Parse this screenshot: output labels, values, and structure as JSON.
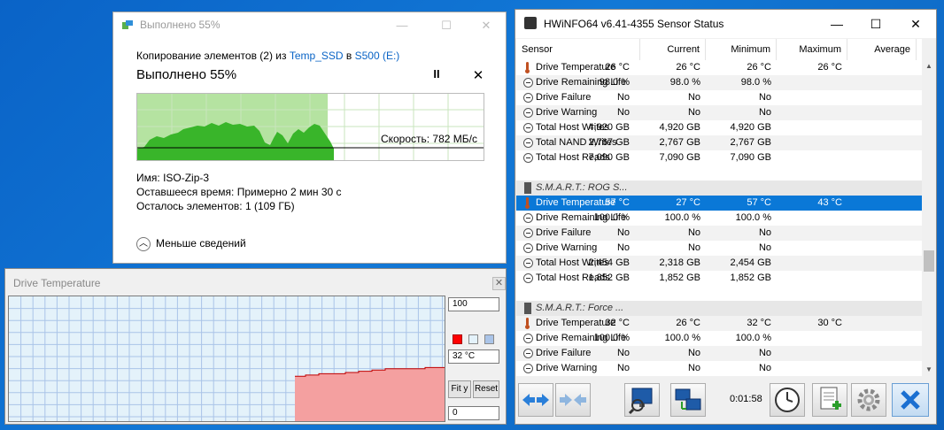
{
  "copy_dialog": {
    "title": "Выполнено 55%",
    "line_prefix": "Копирование элементов (2) из ",
    "source": "Temp_SSD",
    "line_mid": " в ",
    "destination": "S500 (E:)",
    "progress_text": "Выполнено 55%",
    "progress_value": 0.55,
    "speed_label": "Скорость: 782 МБ/с",
    "name_label": "Имя:",
    "name_value": "ISO-Zip-3",
    "time_label": "Оставшееся время:",
    "time_value": "Примерно 2 мин 30 с",
    "items_label": "Осталось элементов:",
    "items_value": "1 (109 ГБ)",
    "less_details": "Меньше сведений",
    "pause_glyph": "II",
    "close_glyph": "✕"
  },
  "drive_temp_window": {
    "title": "Drive Temperature",
    "close_glyph": "✕",
    "max_value": "100",
    "current_value": "32 °C",
    "min_value": "0",
    "fit_label": "Fit y",
    "reset_label": "Reset",
    "trace_color": "#f4a0a0",
    "line_color": "#c00000"
  },
  "hwinfo": {
    "title": "HWiNFO64 v6.41-4355 Sensor Status",
    "min_glyph": "—",
    "max_glyph": "☐",
    "close_glyph": "✕",
    "columns": [
      "Sensor",
      "Current",
      "Minimum",
      "Maximum",
      "Average"
    ],
    "rows": [
      {
        "type": "temp",
        "name": "Drive Temperature",
        "current": "26 °C",
        "min": "26 °C",
        "max": "26 °C",
        "avg": "26 °C"
      },
      {
        "type": "sensor",
        "name": "Drive Remaining Life",
        "current": "98.0 %",
        "min": "98.0 %",
        "max": "98.0 %",
        "avg": ""
      },
      {
        "type": "sensor",
        "name": "Drive Failure",
        "current": "No",
        "min": "No",
        "max": "No",
        "avg": ""
      },
      {
        "type": "sensor",
        "name": "Drive Warning",
        "current": "No",
        "min": "No",
        "max": "No",
        "avg": ""
      },
      {
        "type": "sensor",
        "name": "Total Host Writes",
        "current": "4,920 GB",
        "min": "4,920 GB",
        "max": "4,920 GB",
        "avg": ""
      },
      {
        "type": "sensor",
        "name": "Total NAND Writes",
        "current": "2,767 GB",
        "min": "2,767 GB",
        "max": "2,767 GB",
        "avg": ""
      },
      {
        "type": "sensor",
        "name": "Total Host Reads",
        "current": "7,090 GB",
        "min": "7,090 GB",
        "max": "7,090 GB",
        "avg": ""
      },
      {
        "type": "blank",
        "name": "",
        "current": "",
        "min": "",
        "max": "",
        "avg": ""
      },
      {
        "type": "group",
        "name": "S.M.A.R.T.: ROG S...",
        "current": "",
        "min": "",
        "max": "",
        "avg": ""
      },
      {
        "type": "temp",
        "selected": true,
        "name": "Drive Temperature",
        "current": "57 °C",
        "min": "27 °C",
        "max": "57 °C",
        "avg": "43 °C"
      },
      {
        "type": "sensor",
        "name": "Drive Remaining Life",
        "current": "100.0 %",
        "min": "100.0 %",
        "max": "100.0 %",
        "avg": ""
      },
      {
        "type": "sensor",
        "name": "Drive Failure",
        "current": "No",
        "min": "No",
        "max": "No",
        "avg": ""
      },
      {
        "type": "sensor",
        "name": "Drive Warning",
        "current": "No",
        "min": "No",
        "max": "No",
        "avg": ""
      },
      {
        "type": "sensor",
        "name": "Total Host Writes",
        "current": "2,454 GB",
        "min": "2,318 GB",
        "max": "2,454 GB",
        "avg": ""
      },
      {
        "type": "sensor",
        "name": "Total Host Reads",
        "current": "1,852 GB",
        "min": "1,852 GB",
        "max": "1,852 GB",
        "avg": ""
      },
      {
        "type": "blank",
        "name": "",
        "current": "",
        "min": "",
        "max": "",
        "avg": ""
      },
      {
        "type": "group",
        "name": "S.M.A.R.T.: Force ...",
        "current": "",
        "min": "",
        "max": "",
        "avg": ""
      },
      {
        "type": "temp",
        "name": "Drive Temperature",
        "current": "32 °C",
        "min": "26 °C",
        "max": "32 °C",
        "avg": "30 °C"
      },
      {
        "type": "sensor",
        "name": "Drive Remaining Life",
        "current": "100.0 %",
        "min": "100.0 %",
        "max": "100.0 %",
        "avg": ""
      },
      {
        "type": "sensor",
        "name": "Drive Failure",
        "current": "No",
        "min": "No",
        "max": "No",
        "avg": ""
      },
      {
        "type": "sensor",
        "name": "Drive Warning",
        "current": "No",
        "min": "No",
        "max": "No",
        "avg": ""
      }
    ],
    "timer": "0:01:58",
    "selected_row_color": "#0a78d7"
  }
}
